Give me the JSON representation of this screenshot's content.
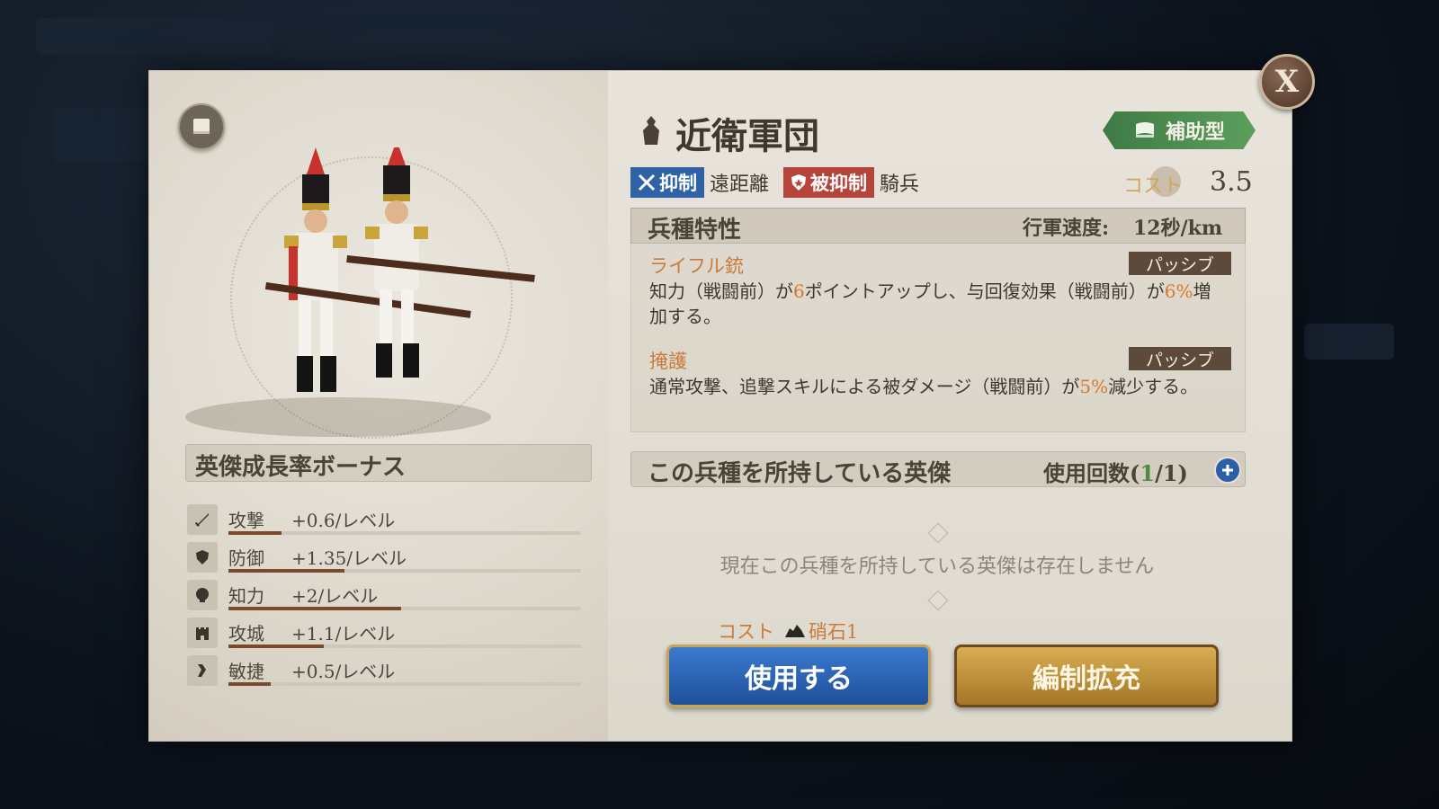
{
  "dialog": {
    "close_label": "X",
    "unit_name": "近衛軍団",
    "unit_type": "補助型",
    "tags": {
      "suppress_label": "抑制",
      "suppress_target": "遠距離",
      "suppressed_label": "被抑制",
      "suppressed_target": "騎兵"
    },
    "cost": {
      "label": "コスト",
      "value": "3.5"
    }
  },
  "traits": {
    "header": "兵種特性",
    "march_speed_label": "行軍速度:",
    "march_speed_value": "12秒/km",
    "skills": [
      {
        "name": "ライフル銃",
        "badge": "パッシブ",
        "desc_part1": "知力（戦闘前）が",
        "desc_hl1": "6",
        "desc_part2": "ポイントアップし、与回復効果（戦闘前）が",
        "desc_hl2": "6%",
        "desc_part3": "増加する。"
      },
      {
        "name": "掩護",
        "badge": "パッシブ",
        "desc_part1": "通常攻撃、追撃スキルによる被ダメージ（戦闘前）が",
        "desc_hl1": "5%",
        "desc_part2": "減少する。"
      }
    ]
  },
  "heroes": {
    "header": "この兵種を所持している英傑",
    "usage_label": "使用回数(",
    "usage_current": "1",
    "usage_total": "/1)",
    "empty_message": "現在この兵種を所持している英傑は存在しません"
  },
  "growth": {
    "header": "英傑成長率ボーナス",
    "stats": [
      {
        "icon": "sword-icon",
        "label": "攻撃",
        "value": "+0.6/レベル",
        "fill": 0.15
      },
      {
        "icon": "shield-icon",
        "label": "防御",
        "value": "+1.35/レベル",
        "fill": 0.33
      },
      {
        "icon": "head-icon",
        "label": "知力",
        "value": "+2/レベル",
        "fill": 0.49
      },
      {
        "icon": "castle-icon",
        "label": "攻城",
        "value": "+1.1/レベル",
        "fill": 0.27
      },
      {
        "icon": "boot-icon",
        "label": "敏捷",
        "value": "+0.5/レベル",
        "fill": 0.12
      }
    ]
  },
  "actions": {
    "cost_label": "コスト",
    "cost_item": "硝石1",
    "use_button": "使用する",
    "expand_button": "編制拡充"
  },
  "colors": {
    "accent_orange": "#d9782d",
    "suppress_blue": "#2f63a6",
    "suppressed_red": "#b5453b",
    "type_green": "#4d8b3f"
  }
}
